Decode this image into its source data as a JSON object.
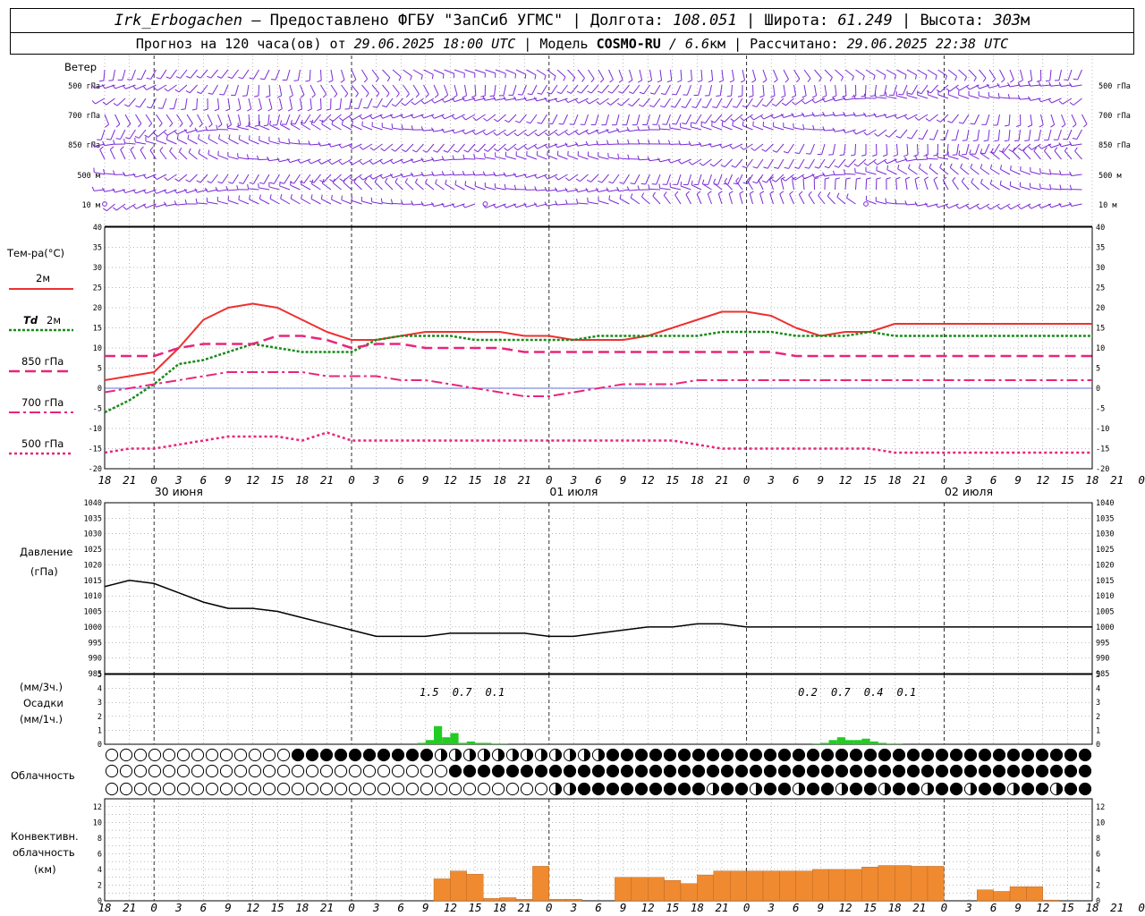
{
  "header": {
    "station": "Irk_Erbogachen",
    "provider": " – Предоставлено ФГБУ \"ЗапСиб УГМС\" | ",
    "lon_label": "Долгота: ",
    "lon": "108.051",
    "lat_label": " | Широта: ",
    "lat": "61.249",
    "alt_label": " | Высота: ",
    "alt": "303",
    "alt_unit": "м",
    "forecast_label": "Прогноз на 120 часа(ов) от ",
    "forecast_time": "29.06.2025 18:00 UTC",
    "model_label": "  | Модель ",
    "model": "COSMO-RU",
    "model_res": " / 6.6",
    "model_res_unit": "км",
    "calc_label": " | Рассчитано: ",
    "calc_time": "29.06.2025 22:38 UTC"
  },
  "labels": {
    "wind": "Ветер",
    "wind_levels": [
      "500 гПа",
      "700 гПа",
      "850 гПа",
      "500 м",
      "10  м"
    ],
    "temp": "Тем-ра(°C)",
    "legend_2m": "2м",
    "legend_td": "Td",
    "legend_td2": "2м",
    "legend_850": "850 гПа",
    "legend_700": "700 гПа",
    "legend_500": "500 гПа",
    "pressure1": "Давление",
    "pressure2": "(гПа)",
    "precip1": "(мм/3ч.)",
    "precip2": "Осадки",
    "precip3": "(мм/1ч.)",
    "cloud": "Облачность",
    "conv1": "Конвективн.",
    "conv2": "облачность",
    "conv3": "(км)"
  },
  "colors": {
    "wind": "#7a2bd6",
    "t2m": "#ee3030",
    "td": "#1a8a1a",
    "t850": "#e8257a",
    "precip": "#22cc22",
    "conv": "#f08a30",
    "zero": "#3344cc"
  },
  "chart_data": [
    {
      "type": "line",
      "title": "Тем-ра(°C)",
      "ylim": [
        -20,
        40
      ],
      "x_hours": [
        0,
        3,
        6,
        9,
        12,
        15,
        18,
        21,
        24,
        27,
        30,
        33,
        36,
        39,
        42,
        45,
        48,
        51,
        54,
        57,
        60,
        63,
        66,
        69,
        72,
        75,
        78,
        81,
        84,
        87,
        90,
        93,
        96,
        99,
        102,
        105,
        108,
        111,
        114,
        117,
        120
      ],
      "x_tick_labels": [
        "18",
        "21",
        "0",
        "3",
        "6",
        "9",
        "12",
        "15",
        "18",
        "21",
        "0",
        "3",
        "6",
        "9",
        "12",
        "15",
        "18",
        "21",
        "0",
        "3",
        "6",
        "9",
        "12",
        "15",
        "18",
        "21",
        "0",
        "3",
        "6",
        "9",
        "12",
        "15",
        "18",
        "21",
        "0",
        "3",
        "6",
        "9",
        "12",
        "15",
        "18",
        "21",
        "0"
      ],
      "dates": [
        "30 июня",
        "01 июля",
        "02 июля"
      ],
      "series": [
        {
          "name": "2м",
          "values": [
            2,
            3,
            4,
            10,
            17,
            20,
            21,
            20,
            17,
            14,
            12,
            12,
            13,
            14,
            14,
            14,
            14,
            13,
            13,
            12,
            12,
            12,
            13,
            15,
            17,
            19,
            19,
            18,
            15,
            13,
            14,
            14,
            16,
            16,
            16,
            16,
            16,
            16,
            16,
            16,
            16
          ]
        },
        {
          "name": "Td 2м",
          "values": [
            -6,
            -3,
            1,
            6,
            7,
            9,
            11,
            10,
            9,
            9,
            9,
            12,
            13,
            13,
            13,
            12,
            12,
            12,
            12,
            12,
            13,
            13,
            13,
            13,
            13,
            14,
            14,
            14,
            13,
            13,
            13,
            14,
            13,
            13,
            13,
            13,
            13,
            13,
            13,
            13,
            13
          ]
        },
        {
          "name": "850 гПа",
          "values": [
            8,
            8,
            8,
            10,
            11,
            11,
            11,
            13,
            13,
            12,
            10,
            11,
            11,
            10,
            10,
            10,
            10,
            9,
            9,
            9,
            9,
            9,
            9,
            9,
            9,
            9,
            9,
            9,
            8,
            8,
            8,
            8,
            8,
            8,
            8,
            8,
            8,
            8,
            8,
            8,
            8
          ]
        },
        {
          "name": "700 гПа",
          "values": [
            -1,
            0,
            1,
            2,
            3,
            4,
            4,
            4,
            4,
            3,
            3,
            3,
            2,
            2,
            1,
            0,
            -1,
            -2,
            -2,
            -1,
            0,
            1,
            1,
            1,
            2,
            2,
            2,
            2,
            2,
            2,
            2,
            2,
            2,
            2,
            2,
            2,
            2,
            2,
            2,
            2,
            2
          ]
        },
        {
          "name": "500 гПа",
          "values": [
            -16,
            -15,
            -15,
            -14,
            -13,
            -12,
            -12,
            -12,
            -13,
            -11,
            -13,
            -13,
            -13,
            -13,
            -13,
            -13,
            -13,
            -13,
            -13,
            -13,
            -13,
            -13,
            -13,
            -13,
            -14,
            -15,
            -15,
            -15,
            -15,
            -15,
            -15,
            -15,
            -16,
            -16,
            -16,
            -16,
            -16,
            -16,
            -16,
            -16,
            -16
          ]
        }
      ]
    },
    {
      "type": "line",
      "title": "Давление",
      "ylabel": "(гПа)",
      "ylim": [
        985,
        1040
      ],
      "x_hours": [
        0,
        3,
        6,
        9,
        12,
        15,
        18,
        21,
        24,
        27,
        30,
        33,
        36,
        39,
        42,
        45,
        48,
        51,
        54,
        57,
        60,
        63,
        66,
        69,
        72,
        75,
        78,
        81,
        84,
        87,
        90,
        93,
        96,
        99,
        102,
        105,
        108,
        111,
        114,
        117,
        120
      ],
      "series": [
        {
          "name": "Давление",
          "values": [
            1013,
            1015,
            1014,
            1011,
            1008,
            1006,
            1006,
            1005,
            1003,
            1001,
            999,
            997,
            997,
            997,
            998,
            998,
            998,
            998,
            997,
            997,
            998,
            999,
            1000,
            1000,
            1001,
            1001,
            1000,
            1000,
            1000,
            1000,
            1000,
            1000,
            1000,
            1000,
            1000,
            1000,
            1000,
            1000,
            1000,
            1000,
            1000
          ]
        }
      ]
    },
    {
      "type": "bar",
      "title": "Осадки",
      "ylim": [
        0,
        5
      ],
      "x_hours": [
        38,
        39,
        40,
        41,
        42,
        43,
        44,
        45,
        46,
        47,
        48,
        49,
        86,
        87,
        88,
        89,
        90,
        91,
        92,
        93,
        94,
        95,
        96,
        97
      ],
      "values": [
        0.1,
        0.3,
        1.3,
        0.5,
        0.8,
        0.1,
        0.2,
        0.1,
        0.1,
        0.05,
        0.05,
        0,
        0.05,
        0.1,
        0.3,
        0.5,
        0.3,
        0.3,
        0.4,
        0.2,
        0.1,
        0.05,
        0.05,
        0
      ],
      "annotations": [
        "1.5",
        "0.7",
        "0.1",
        "0.2",
        "0.7",
        "0.4",
        "0.1"
      ]
    },
    {
      "type": "bar",
      "title": "Конвективн. облачность",
      "ylim": [
        0,
        13
      ],
      "ylabel": "(км)",
      "x_hours": [
        40,
        42,
        44,
        46,
        48,
        50,
        52,
        54,
        56,
        58,
        60,
        62,
        64,
        66,
        68,
        70,
        72,
        74,
        76,
        78,
        80,
        82,
        84,
        86,
        88,
        90,
        92,
        94,
        96,
        98,
        100,
        102,
        104,
        106,
        108,
        110,
        112,
        114,
        116,
        118
      ],
      "values": [
        2.8,
        3.8,
        3.4,
        0.3,
        0.4,
        0.2,
        4.4,
        0.2,
        0.2,
        0,
        0,
        3,
        3,
        3,
        2.6,
        2.2,
        3.3,
        3.8,
        3.8,
        3.8,
        3.8,
        3.8,
        3.8,
        4,
        4,
        4,
        4.3,
        4.5,
        4.5,
        4.4,
        4.4,
        0,
        0,
        1.4,
        1.2,
        1.8,
        1.8,
        0.1,
        0,
        0
      ]
    }
  ]
}
